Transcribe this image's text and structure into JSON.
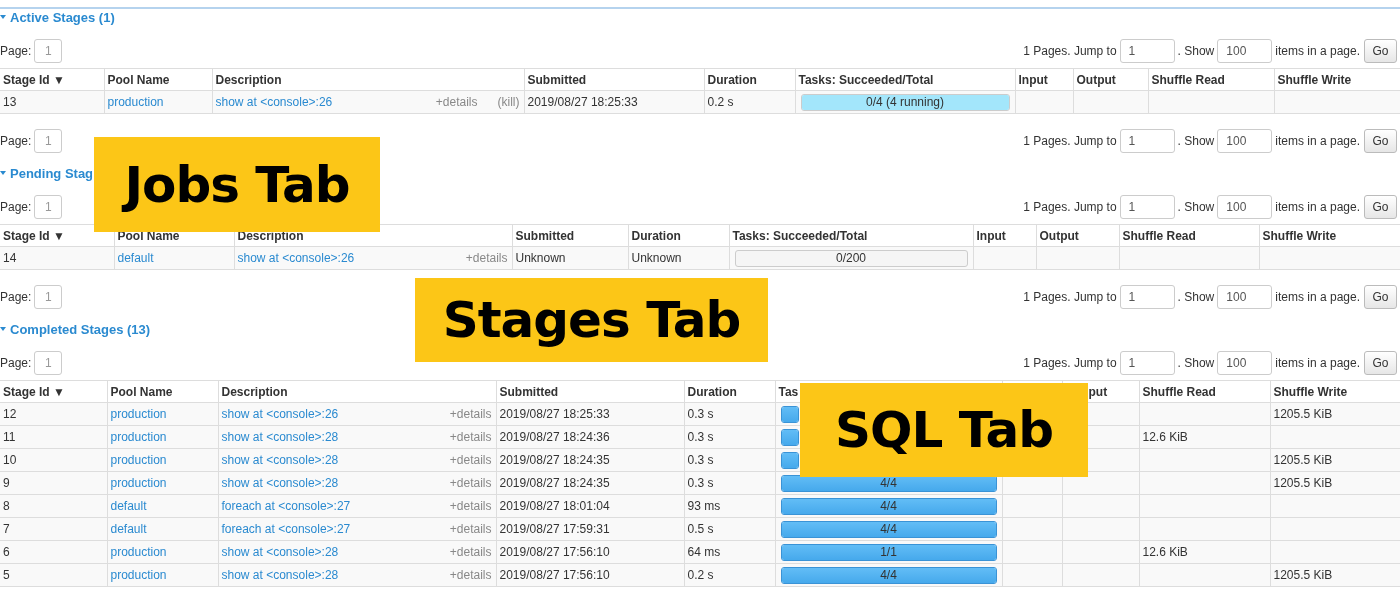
{
  "sections": [
    {
      "title": "Active Stages (1)",
      "expanded": true,
      "pager_top": {
        "page_label": "Page:",
        "page": "1",
        "summary": "1 Pages. Jump to",
        "jump": "1",
        "show_label": ". Show",
        "show": "100",
        "items_label": "items in a page.",
        "go": "Go"
      },
      "table": {
        "columns": [
          {
            "label": "Stage Id ▼"
          },
          {
            "label": "Pool Name"
          },
          {
            "label": "Description"
          },
          {
            "label": "Submitted"
          },
          {
            "label": "Duration"
          },
          {
            "label": "Tasks: Succeeded/Total"
          },
          {
            "label": "Input"
          },
          {
            "label": "Output"
          },
          {
            "label": "Shuffle Read"
          },
          {
            "label": "Shuffle Write"
          }
        ],
        "rows": [
          {
            "stage_id": "13",
            "pool": "production",
            "description": "show at <console>:26",
            "details": "+details",
            "kill": "(kill)",
            "submitted": "2019/08/27 18:25:33",
            "duration": "0.2 s",
            "tasks": {
              "label": "0/4 (4 running)",
              "level": 0,
              "kind": "running"
            }
          }
        ]
      },
      "pager_bottom": {
        "page_label": "Page:",
        "page": "1",
        "summary": "1 Pages. Jump to",
        "jump": "1",
        "show_label": ". Show",
        "show": "100",
        "items_label": "items in a page.",
        "go": "Go"
      }
    },
    {
      "title": "Pending Stag",
      "expanded": true,
      "pager_top": {
        "page_label": "Page:",
        "page": "1",
        "summary": "1 Pages. Jump to",
        "jump": "1",
        "show_label": ". Show",
        "show": "100",
        "items_label": "items in a page.",
        "go": "Go"
      },
      "table": {
        "columns": [
          {
            "label": "Stage Id ▼"
          },
          {
            "label": "Pool Name"
          },
          {
            "label": "Description"
          },
          {
            "label": "Submitted"
          },
          {
            "label": "Duration"
          },
          {
            "label": "Tasks: Succeeded/Total"
          },
          {
            "label": "Input"
          },
          {
            "label": "Output"
          },
          {
            "label": "Shuffle Read"
          },
          {
            "label": "Shuffle Write"
          }
        ],
        "rows": [
          {
            "stage_id": "14",
            "pool": "default",
            "description": "show at <console>:26",
            "details": "+details",
            "submitted": "Unknown",
            "duration": "Unknown",
            "tasks": {
              "label": "0/200",
              "level": 0,
              "kind": "pending"
            }
          }
        ]
      },
      "pager_bottom": {
        "page_label": "Page:",
        "page": "1",
        "summary": "1 Pages. Jump to",
        "jump": "1",
        "show_label": ". Show",
        "show": "100",
        "items_label": "items in a page.",
        "go": "Go"
      }
    },
    {
      "title": "Completed Stages (13)",
      "expanded": true,
      "pager_top": {
        "page_label": "Page:",
        "page": "1",
        "summary": "1 Pages. Jump to",
        "jump": "1",
        "show_label": ". Show",
        "show": "100",
        "items_label": "items in a page.",
        "go": "Go"
      },
      "table": {
        "columns": [
          {
            "label": "Stage Id ▼"
          },
          {
            "label": "Pool Name"
          },
          {
            "label": "Description"
          },
          {
            "label": "Submitted"
          },
          {
            "label": "Duration"
          },
          {
            "label": "Tas"
          },
          {},
          {
            "label": "put"
          },
          {
            "label": "Shuffle Read"
          },
          {
            "label": "Shuffle Write"
          }
        ],
        "rows": [
          {
            "stage_id": "12",
            "pool": "production",
            "description": "show at <console>:26",
            "details": "+details",
            "submitted": "2019/08/27 18:25:33",
            "duration": "0.3 s",
            "tasks": {
              "level": 1,
              "kind": "complete"
            },
            "shuffle_write": "1205.5 KiB"
          },
          {
            "stage_id": "11",
            "pool": "production",
            "description": "show at <console>:28",
            "details": "+details",
            "submitted": "2019/08/27 18:24:36",
            "duration": "0.3 s",
            "tasks": {
              "level": 1,
              "kind": "complete"
            },
            "shuffle_read": "12.6 KiB"
          },
          {
            "stage_id": "10",
            "pool": "production",
            "description": "show at <console>:28",
            "details": "+details",
            "submitted": "2019/08/27 18:24:35",
            "duration": "0.3 s",
            "tasks": {
              "level": 1,
              "kind": "complete"
            },
            "shuffle_write": "1205.5 KiB"
          },
          {
            "stage_id": "9",
            "pool": "production",
            "description": "show at <console>:28",
            "details": "+details",
            "submitted": "2019/08/27 18:24:35",
            "duration": "0.3 s",
            "tasks": {
              "label": "4/4",
              "level": 1,
              "kind": "complete"
            },
            "shuffle_write": "1205.5 KiB"
          },
          {
            "stage_id": "8",
            "pool": "default",
            "description": "foreach at <console>:27",
            "details": "+details",
            "submitted": "2019/08/27 18:01:04",
            "duration": "93 ms",
            "tasks": {
              "label": "4/4",
              "level": 1,
              "kind": "complete"
            }
          },
          {
            "stage_id": "7",
            "pool": "default",
            "description": "foreach at <console>:27",
            "details": "+details",
            "submitted": "2019/08/27 17:59:31",
            "duration": "0.5 s",
            "tasks": {
              "label": "4/4",
              "level": 1,
              "kind": "complete"
            }
          },
          {
            "stage_id": "6",
            "pool": "production",
            "description": "show at <console>:28",
            "details": "+details",
            "submitted": "2019/08/27 17:56:10",
            "duration": "64 ms",
            "tasks": {
              "label": "1/1",
              "level": 1,
              "kind": "complete"
            },
            "shuffle_read": "12.6 KiB"
          },
          {
            "stage_id": "5",
            "pool": "production",
            "description": "show at <console>:28",
            "details": "+details",
            "submitted": "2019/08/27 17:56:10",
            "duration": "0.2 s",
            "tasks": {
              "label": "4/4",
              "level": 1,
              "kind": "complete"
            },
            "shuffle_write": "1205.5 KiB"
          }
        ]
      }
    }
  ],
  "overlays": [
    {
      "text": "Jobs Tab"
    },
    {
      "text": "Stages Tab"
    },
    {
      "text": "SQL Tab"
    }
  ]
}
